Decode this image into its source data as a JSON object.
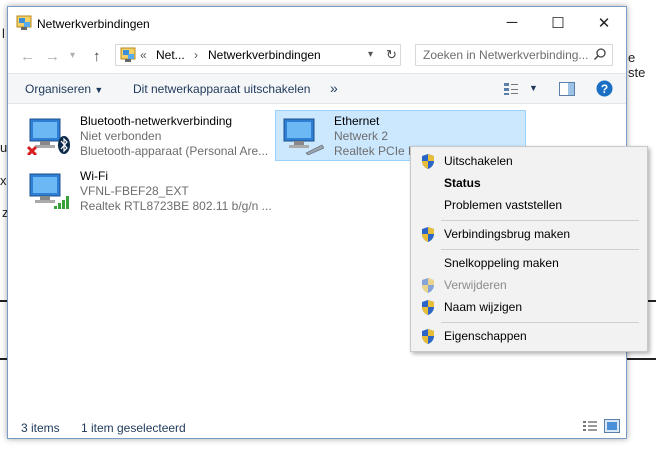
{
  "background": {
    "left_fragments": [
      "l",
      "u",
      "x",
      "z"
    ],
    "right_fragment": "e ste"
  },
  "window": {
    "title": "Netwerkverbindingen",
    "controls": {
      "minimize": "─",
      "maximize": "☐",
      "close": "✕"
    }
  },
  "address": {
    "separator": "«",
    "segment1": "Net...",
    "arrow": "›",
    "segment2": "Netwerkverbindingen"
  },
  "search": {
    "placeholder": "Zoeken in Netwerkverbinding..."
  },
  "toolbar": {
    "organize": "Organiseren",
    "disable_device": "Dit netwerkapparaat uitschakelen",
    "more": "»"
  },
  "items": [
    {
      "name": "Bluetooth-netwerkverbinding",
      "status": "Niet verbonden",
      "device": "Bluetooth-apparaat (Personal Are..."
    },
    {
      "name": "Wi-Fi",
      "status": "VFNL-FBEF28_EXT",
      "device": "Realtek RTL8723BE 802.11 b/g/n ..."
    },
    {
      "name": "Ethernet",
      "status": "Netwerk  2",
      "device": "Realtek PCIe FE"
    }
  ],
  "statusbar": {
    "count": "3 items",
    "selected": "1 item geselecteerd"
  },
  "context_menu": {
    "items": [
      {
        "label": "Uitschakelen",
        "shield": true
      },
      {
        "label": "Status",
        "bold": true
      },
      {
        "label": "Problemen vaststellen"
      },
      {
        "label": "Verbindingsbrug maken",
        "shield": true
      },
      {
        "label": "Snelkoppeling maken"
      },
      {
        "label": "Verwijderen",
        "shield": true,
        "disabled": true
      },
      {
        "label": "Naam wijzigen",
        "shield": true
      },
      {
        "label": "Eigenschappen",
        "shield": true
      }
    ]
  },
  "colors": {
    "selection": "#cce8ff",
    "selection_border": "#99d1ff",
    "accent": "#1e395b",
    "help": "#1a6fc4"
  }
}
